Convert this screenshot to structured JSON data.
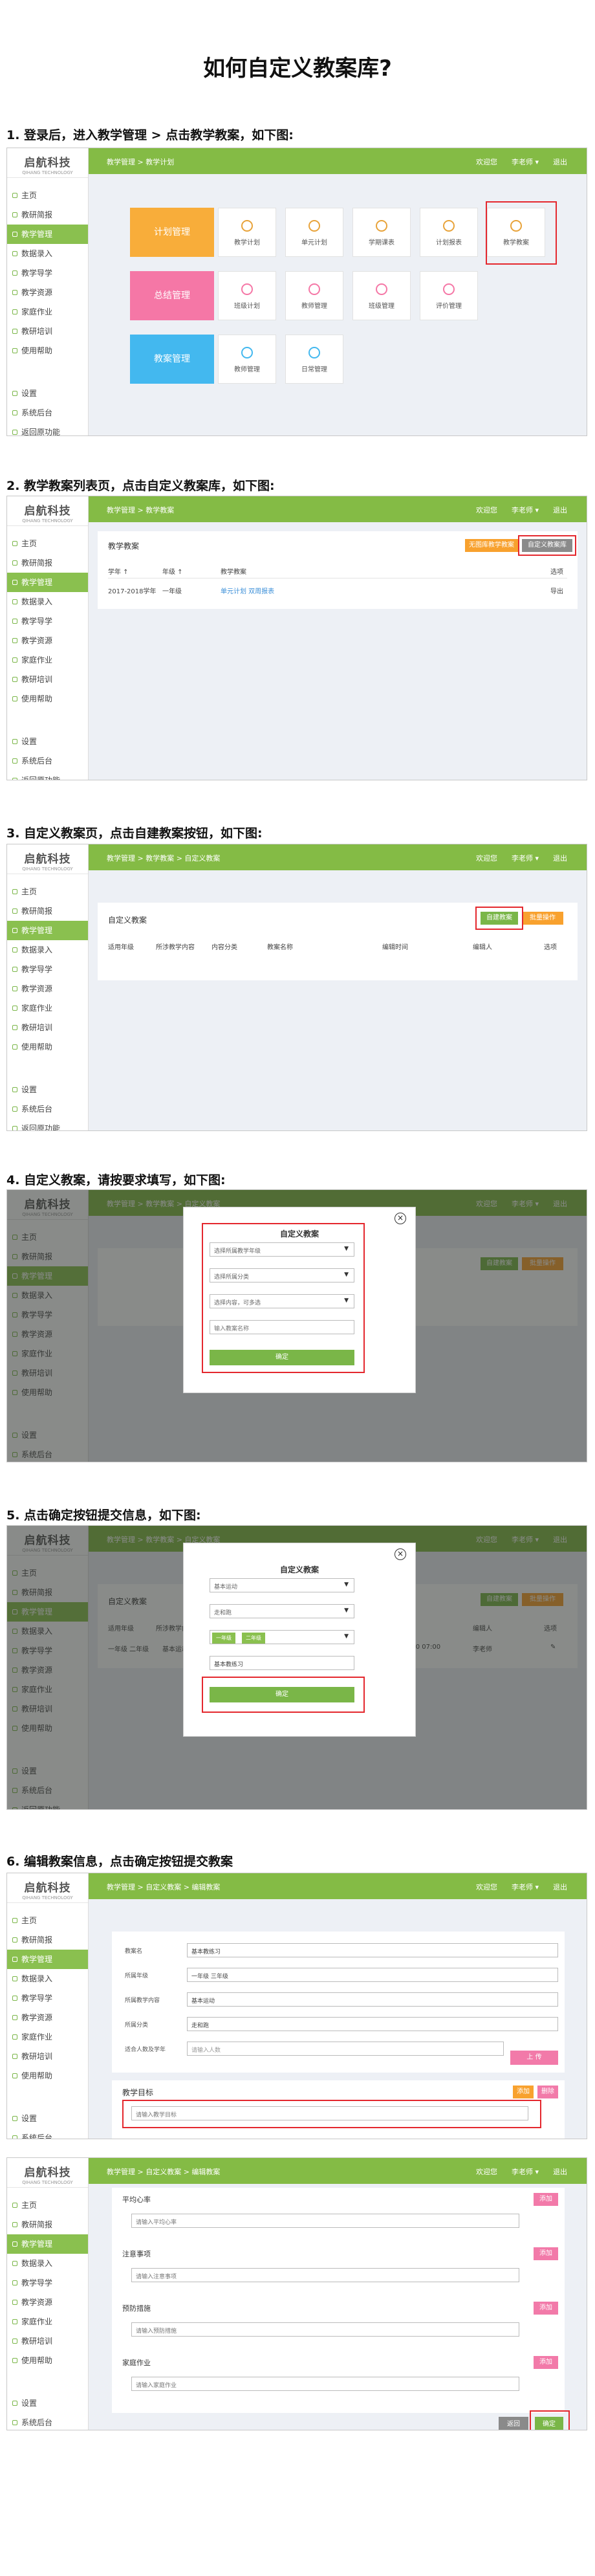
{
  "title": "如何自定义教案库?",
  "steps": [
    "1.  登录后，进入教学管理 > 点击教学教案，如下图:",
    "2.  教学教案列表页，点击自定义教案库，如下图:",
    "3. 自定义教案页，点击自建教案按钮，如下图:",
    "4.  自定义教案，请按要求填写，如下图:",
    "5.  点击确定按钮提交信息，如下图:",
    "6.  编辑教案信息，点击确定按钮提交教案"
  ],
  "logo": {
    "text": "启航科技",
    "sub": "QIHANG TECHNOLOGY"
  },
  "sidebar": {
    "items": [
      "主页",
      "教研简报",
      "教学管理",
      "数据录入",
      "教学导学",
      "教学资源",
      "家庭作业",
      "教研培训",
      "使用帮助"
    ],
    "bottom": [
      "设置",
      "系统后台",
      "返回原功能"
    ]
  },
  "topbar": {
    "right": [
      "欢迎您",
      "李老师 ▾",
      "退出"
    ],
    "crumb1": "教学管理 > 教学计划",
    "crumb2": "教学管理 > 教学教案",
    "crumb3": "教学管理 > 教学教案 > 自定义教案",
    "crumb6": "教学管理 > 自定义教案 > 编辑教案"
  },
  "shot1": {
    "big": [
      "计划管理",
      "总结管理",
      "教案管理"
    ],
    "row1": [
      "教学计划",
      "单元计划",
      "学期课表",
      "计划报表",
      "教学教案"
    ],
    "row2": [
      "班级计划",
      "教师管理",
      "班级管理",
      "评价管理"
    ],
    "row3": [
      "教师管理",
      "日常管理"
    ]
  },
  "shot2": {
    "heading": "教学教案",
    "btn_orange": "无图库教学教案",
    "btn_custom": "自定义教案库",
    "cols": [
      "学年 ↑",
      "年级 ↑",
      "教学教案",
      "选项"
    ],
    "row": [
      "2017-2018学年",
      "一年级",
      "单元计划 双周报表",
      "导出"
    ]
  },
  "shot3": {
    "heading": "自定义教案",
    "btn_new": "自建教案",
    "btn_other": "批量操作",
    "cols": [
      "适用年级",
      "所涉教学内容",
      "内容分类",
      "教案名称",
      "编辑时间",
      "编辑人",
      "选项"
    ]
  },
  "shot4": {
    "modal_title": "自定义教案",
    "fields": [
      "选择所属教学年级",
      "选择所属分类",
      "选择内容，可多选",
      "输入教案名称"
    ],
    "confirm": "确定"
  },
  "shot5": {
    "modal_title": "自定义教案",
    "fields": [
      "基本运动",
      "走和跑"
    ],
    "tags": [
      "一年级",
      "二年级"
    ],
    "name": "基本教练习",
    "confirm": "确定",
    "row": [
      "一年级 二年级",
      "基本运动",
      "走和跑",
      "基本教练习",
      "2018-05-10 07:00",
      "李老师",
      "✎"
    ]
  },
  "shot6": {
    "labels": [
      "教案名",
      "所属年级",
      "所属教学内容",
      "所属分类",
      "适合人数及学年"
    ],
    "values": [
      "基本教练习",
      "一年级   三年级",
      "基本运动",
      "走和跑",
      "请输入人数"
    ],
    "btn_upload": "上 传",
    "section": "教学目标",
    "sec_btn1": "添加",
    "sec_btn2": "删除",
    "placeholder": "请输入教学目标"
  },
  "shot7": {
    "items": [
      "平均心率",
      "注意事项",
      "预防措施",
      "家庭作业"
    ],
    "placeholders": [
      "请输入平均心率",
      "请输入注意事项",
      "请输入预防措施",
      "请输入家庭作业"
    ],
    "btn_add": "添加",
    "btn_back": "返回",
    "btn_ok": "确定"
  }
}
